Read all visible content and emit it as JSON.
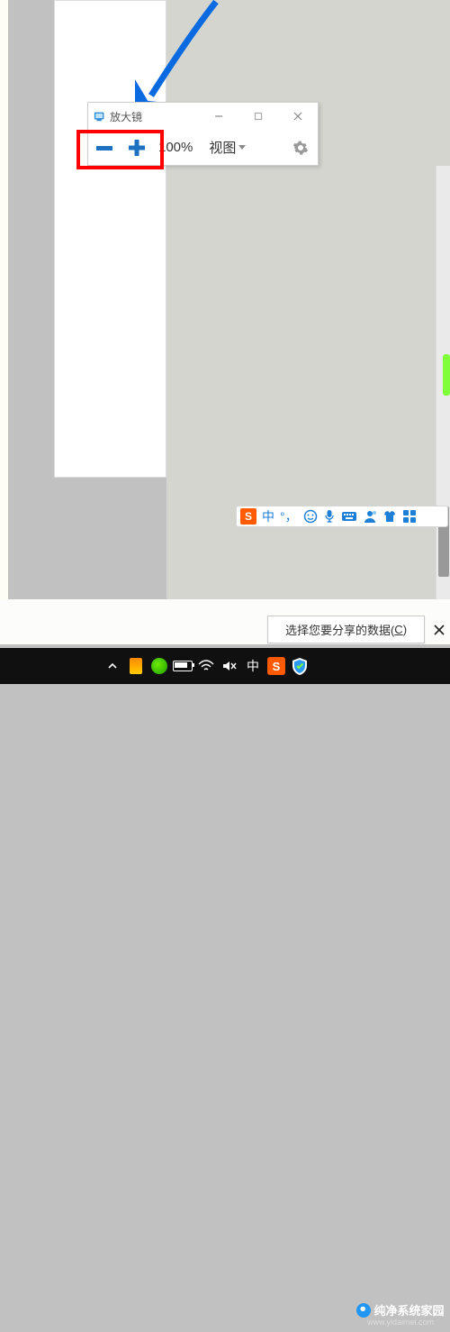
{
  "magnifier": {
    "title": "放大镜",
    "minus": "−",
    "plus": "+",
    "zoom_pct": "100%",
    "view_label": "视图"
  },
  "ime": {
    "logo_letter": "S",
    "mode": "中",
    "punct": "，",
    "emoji": "☺",
    "mic": "mic",
    "kbd": "kbd",
    "person": "person",
    "shirt": "shirt",
    "grid": "grid"
  },
  "share_prompt": {
    "text": "选择您要分享的数据(",
    "hotkey": "C",
    "suffix": ")"
  },
  "taskbar": {
    "ime_char": "中",
    "sogou": "S"
  },
  "watermark": {
    "main": "纯净系统家园",
    "sub": "www.yidaimei.com"
  }
}
